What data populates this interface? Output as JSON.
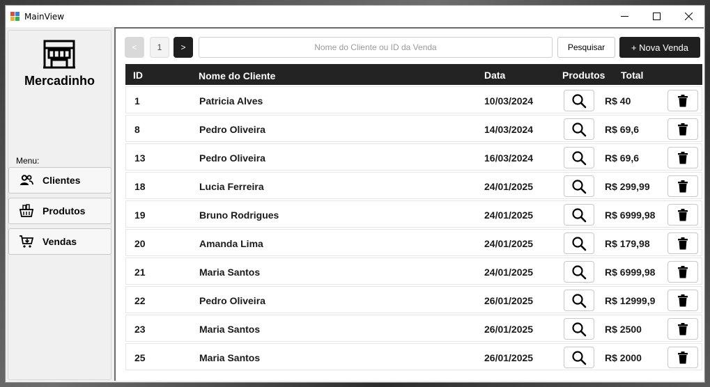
{
  "window": {
    "title": "MainView"
  },
  "sidebar": {
    "brand": "Mercadinho",
    "menu_label": "Menu:",
    "items": [
      {
        "label": "Clientes",
        "icon": "users-icon"
      },
      {
        "label": "Produtos",
        "icon": "basket-icon"
      },
      {
        "label": "Vendas",
        "icon": "cart-icon"
      }
    ]
  },
  "toolbar": {
    "prev_label": "<",
    "page_number": "1",
    "next_label": ">",
    "search_placeholder": "Nome do Cliente ou ID da Venda",
    "search_label": "Pesquisar",
    "new_sale_label": "+ Nova Venda"
  },
  "table": {
    "headers": {
      "id": "ID",
      "client": "Nome do Cliente",
      "date": "Data",
      "products": "Produtos",
      "total": "Total"
    },
    "rows": [
      {
        "id": "1",
        "client": "Patricia Alves",
        "date": "10/03/2024",
        "total": "R$ 40"
      },
      {
        "id": "8",
        "client": "Pedro Oliveira",
        "date": "14/03/2024",
        "total": "R$ 69,6"
      },
      {
        "id": "13",
        "client": "Pedro Oliveira",
        "date": "16/03/2024",
        "total": "R$ 69,6"
      },
      {
        "id": "18",
        "client": "Lucia Ferreira",
        "date": "24/01/2025",
        "total": "R$ 299,99"
      },
      {
        "id": "19",
        "client": "Bruno Rodrigues",
        "date": "24/01/2025",
        "total": "R$ 6999,98"
      },
      {
        "id": "20",
        "client": "Amanda Lima",
        "date": "24/01/2025",
        "total": "R$ 179,98"
      },
      {
        "id": "21",
        "client": "Maria Santos",
        "date": "24/01/2025",
        "total": "R$ 6999,98"
      },
      {
        "id": "22",
        "client": "Pedro Oliveira",
        "date": "26/01/2025",
        "total": "R$ 12999,9"
      },
      {
        "id": "23",
        "client": "Maria Santos",
        "date": "26/01/2025",
        "total": "R$ 2500"
      },
      {
        "id": "25",
        "client": "Maria Santos",
        "date": "26/01/2025",
        "total": "R$ 2000"
      }
    ]
  },
  "colors": {
    "header_bg": "#232323",
    "accent_dark": "#1f1f1f",
    "window_bg": "#f0f0f0"
  }
}
